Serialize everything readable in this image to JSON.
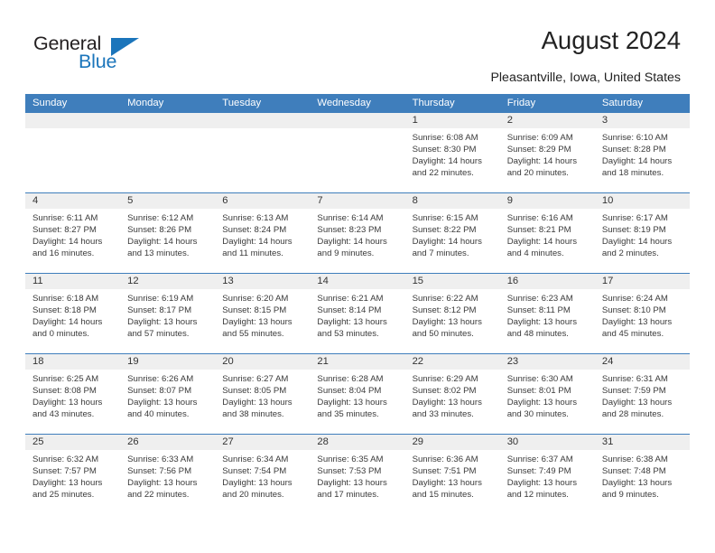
{
  "brand": {
    "name_part1": "General",
    "name_part2": "Blue",
    "triangle_color": "#1b75bb"
  },
  "header": {
    "title": "August 2024",
    "subtitle": "Pleasantville, Iowa, United States"
  },
  "theme": {
    "header_blue": "#3f7ebc",
    "daynum_band": "#efefef",
    "text": "#3a3a3a"
  },
  "weekdays": [
    "Sunday",
    "Monday",
    "Tuesday",
    "Wednesday",
    "Thursday",
    "Friday",
    "Saturday"
  ],
  "weeks": [
    [
      {
        "empty": true
      },
      {
        "empty": true
      },
      {
        "empty": true
      },
      {
        "empty": true
      },
      {
        "day": "1",
        "sunrise": "Sunrise: 6:08 AM",
        "sunset": "Sunset: 8:30 PM",
        "daylight_1": "Daylight: 14 hours",
        "daylight_2": "and 22 minutes."
      },
      {
        "day": "2",
        "sunrise": "Sunrise: 6:09 AM",
        "sunset": "Sunset: 8:29 PM",
        "daylight_1": "Daylight: 14 hours",
        "daylight_2": "and 20 minutes."
      },
      {
        "day": "3",
        "sunrise": "Sunrise: 6:10 AM",
        "sunset": "Sunset: 8:28 PM",
        "daylight_1": "Daylight: 14 hours",
        "daylight_2": "and 18 minutes."
      }
    ],
    [
      {
        "day": "4",
        "sunrise": "Sunrise: 6:11 AM",
        "sunset": "Sunset: 8:27 PM",
        "daylight_1": "Daylight: 14 hours",
        "daylight_2": "and 16 minutes."
      },
      {
        "day": "5",
        "sunrise": "Sunrise: 6:12 AM",
        "sunset": "Sunset: 8:26 PM",
        "daylight_1": "Daylight: 14 hours",
        "daylight_2": "and 13 minutes."
      },
      {
        "day": "6",
        "sunrise": "Sunrise: 6:13 AM",
        "sunset": "Sunset: 8:24 PM",
        "daylight_1": "Daylight: 14 hours",
        "daylight_2": "and 11 minutes."
      },
      {
        "day": "7",
        "sunrise": "Sunrise: 6:14 AM",
        "sunset": "Sunset: 8:23 PM",
        "daylight_1": "Daylight: 14 hours",
        "daylight_2": "and 9 minutes."
      },
      {
        "day": "8",
        "sunrise": "Sunrise: 6:15 AM",
        "sunset": "Sunset: 8:22 PM",
        "daylight_1": "Daylight: 14 hours",
        "daylight_2": "and 7 minutes."
      },
      {
        "day": "9",
        "sunrise": "Sunrise: 6:16 AM",
        "sunset": "Sunset: 8:21 PM",
        "daylight_1": "Daylight: 14 hours",
        "daylight_2": "and 4 minutes."
      },
      {
        "day": "10",
        "sunrise": "Sunrise: 6:17 AM",
        "sunset": "Sunset: 8:19 PM",
        "daylight_1": "Daylight: 14 hours",
        "daylight_2": "and 2 minutes."
      }
    ],
    [
      {
        "day": "11",
        "sunrise": "Sunrise: 6:18 AM",
        "sunset": "Sunset: 8:18 PM",
        "daylight_1": "Daylight: 14 hours",
        "daylight_2": "and 0 minutes."
      },
      {
        "day": "12",
        "sunrise": "Sunrise: 6:19 AM",
        "sunset": "Sunset: 8:17 PM",
        "daylight_1": "Daylight: 13 hours",
        "daylight_2": "and 57 minutes."
      },
      {
        "day": "13",
        "sunrise": "Sunrise: 6:20 AM",
        "sunset": "Sunset: 8:15 PM",
        "daylight_1": "Daylight: 13 hours",
        "daylight_2": "and 55 minutes."
      },
      {
        "day": "14",
        "sunrise": "Sunrise: 6:21 AM",
        "sunset": "Sunset: 8:14 PM",
        "daylight_1": "Daylight: 13 hours",
        "daylight_2": "and 53 minutes."
      },
      {
        "day": "15",
        "sunrise": "Sunrise: 6:22 AM",
        "sunset": "Sunset: 8:12 PM",
        "daylight_1": "Daylight: 13 hours",
        "daylight_2": "and 50 minutes."
      },
      {
        "day": "16",
        "sunrise": "Sunrise: 6:23 AM",
        "sunset": "Sunset: 8:11 PM",
        "daylight_1": "Daylight: 13 hours",
        "daylight_2": "and 48 minutes."
      },
      {
        "day": "17",
        "sunrise": "Sunrise: 6:24 AM",
        "sunset": "Sunset: 8:10 PM",
        "daylight_1": "Daylight: 13 hours",
        "daylight_2": "and 45 minutes."
      }
    ],
    [
      {
        "day": "18",
        "sunrise": "Sunrise: 6:25 AM",
        "sunset": "Sunset: 8:08 PM",
        "daylight_1": "Daylight: 13 hours",
        "daylight_2": "and 43 minutes."
      },
      {
        "day": "19",
        "sunrise": "Sunrise: 6:26 AM",
        "sunset": "Sunset: 8:07 PM",
        "daylight_1": "Daylight: 13 hours",
        "daylight_2": "and 40 minutes."
      },
      {
        "day": "20",
        "sunrise": "Sunrise: 6:27 AM",
        "sunset": "Sunset: 8:05 PM",
        "daylight_1": "Daylight: 13 hours",
        "daylight_2": "and 38 minutes."
      },
      {
        "day": "21",
        "sunrise": "Sunrise: 6:28 AM",
        "sunset": "Sunset: 8:04 PM",
        "daylight_1": "Daylight: 13 hours",
        "daylight_2": "and 35 minutes."
      },
      {
        "day": "22",
        "sunrise": "Sunrise: 6:29 AM",
        "sunset": "Sunset: 8:02 PM",
        "daylight_1": "Daylight: 13 hours",
        "daylight_2": "and 33 minutes."
      },
      {
        "day": "23",
        "sunrise": "Sunrise: 6:30 AM",
        "sunset": "Sunset: 8:01 PM",
        "daylight_1": "Daylight: 13 hours",
        "daylight_2": "and 30 minutes."
      },
      {
        "day": "24",
        "sunrise": "Sunrise: 6:31 AM",
        "sunset": "Sunset: 7:59 PM",
        "daylight_1": "Daylight: 13 hours",
        "daylight_2": "and 28 minutes."
      }
    ],
    [
      {
        "day": "25",
        "sunrise": "Sunrise: 6:32 AM",
        "sunset": "Sunset: 7:57 PM",
        "daylight_1": "Daylight: 13 hours",
        "daylight_2": "and 25 minutes."
      },
      {
        "day": "26",
        "sunrise": "Sunrise: 6:33 AM",
        "sunset": "Sunset: 7:56 PM",
        "daylight_1": "Daylight: 13 hours",
        "daylight_2": "and 22 minutes."
      },
      {
        "day": "27",
        "sunrise": "Sunrise: 6:34 AM",
        "sunset": "Sunset: 7:54 PM",
        "daylight_1": "Daylight: 13 hours",
        "daylight_2": "and 20 minutes."
      },
      {
        "day": "28",
        "sunrise": "Sunrise: 6:35 AM",
        "sunset": "Sunset: 7:53 PM",
        "daylight_1": "Daylight: 13 hours",
        "daylight_2": "and 17 minutes."
      },
      {
        "day": "29",
        "sunrise": "Sunrise: 6:36 AM",
        "sunset": "Sunset: 7:51 PM",
        "daylight_1": "Daylight: 13 hours",
        "daylight_2": "and 15 minutes."
      },
      {
        "day": "30",
        "sunrise": "Sunrise: 6:37 AM",
        "sunset": "Sunset: 7:49 PM",
        "daylight_1": "Daylight: 13 hours",
        "daylight_2": "and 12 minutes."
      },
      {
        "day": "31",
        "sunrise": "Sunrise: 6:38 AM",
        "sunset": "Sunset: 7:48 PM",
        "daylight_1": "Daylight: 13 hours",
        "daylight_2": "and 9 minutes."
      }
    ]
  ]
}
